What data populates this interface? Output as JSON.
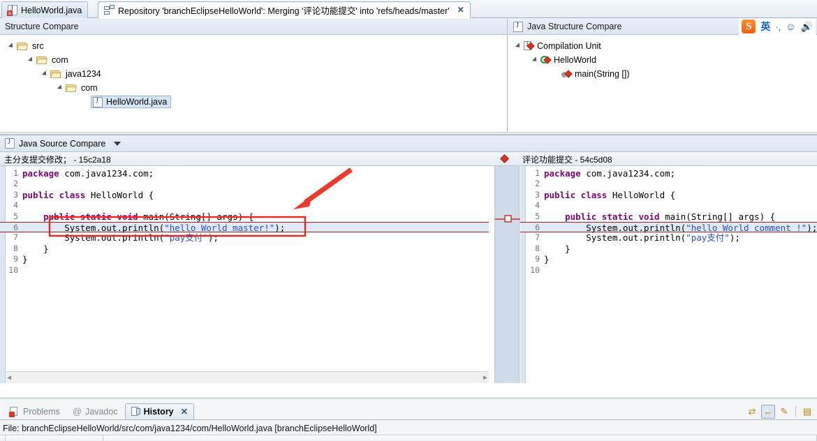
{
  "tabs": {
    "inactive": {
      "label": "HelloWorld.java",
      "icon": "java-file-error-icon"
    },
    "active": {
      "label": "Repository 'branchEclipseHelloWorld': Merging '评论功能提交' into 'refs/heads/master'",
      "icon": "repository-merge-icon",
      "close": "✕"
    }
  },
  "structure_compare": {
    "left": {
      "title": "Structure Compare",
      "tree": [
        {
          "label": "src",
          "depth": 0,
          "expanded": true,
          "icon": "folder-icon",
          "selected": false
        },
        {
          "label": "com",
          "depth": 1,
          "expanded": true,
          "icon": "folder-icon",
          "selected": false
        },
        {
          "label": "java1234",
          "depth": 2,
          "expanded": true,
          "icon": "folder-icon",
          "selected": false
        },
        {
          "label": "com",
          "depth": 3,
          "expanded": true,
          "icon": "folder-icon",
          "selected": false
        },
        {
          "label": "HelloWorld.java",
          "depth": 4,
          "expanded": false,
          "icon": "java-file-icon",
          "selected": true
        }
      ]
    },
    "right": {
      "title": "Java Structure Compare",
      "title_icon": "java-file-icon",
      "tree": [
        {
          "label": "Compilation Unit",
          "depth": 0,
          "expanded": true,
          "icon": "compilation-unit-icon",
          "changed": true
        },
        {
          "label": "HelloWorld",
          "depth": 1,
          "expanded": true,
          "icon": "java-class-icon",
          "changed": true
        },
        {
          "label": "main(String [])",
          "depth": 2,
          "expanded": false,
          "icon": "java-method-icon",
          "changed": true
        }
      ]
    }
  },
  "ime_toolbar": {
    "logo": "S",
    "items": [
      "英",
      "·,",
      "☺",
      "🎤"
    ],
    "names": [
      "sogou-logo-icon",
      "english-mode-icon",
      "punctuation-icon",
      "emoji-icon",
      "voice-input-icon"
    ]
  },
  "source_compare": {
    "title": "Java Source Compare",
    "title_icon": "java-file-icon",
    "menu_caret": "▼",
    "left_header": "主分支提交修改； - 15c2a18",
    "right_header": "评论功能提交 - 54c5d08",
    "left_code": [
      {
        "num": "1",
        "tokens": [
          {
            "t": "package ",
            "c": "kw"
          },
          {
            "t": "com.java1234.com;",
            "c": "plain"
          }
        ]
      },
      {
        "num": "2",
        "tokens": []
      },
      {
        "num": "3",
        "tokens": [
          {
            "t": "public class ",
            "c": "kw"
          },
          {
            "t": "HelloWorld {",
            "c": "plain"
          }
        ]
      },
      {
        "num": "4",
        "tokens": []
      },
      {
        "num": "5",
        "tokens": [
          {
            "t": "    ",
            "c": "plain"
          },
          {
            "t": "public static void ",
            "c": "kw"
          },
          {
            "t": "main(String[] args) {",
            "c": "plain"
          }
        ]
      },
      {
        "num": "6",
        "diff": true,
        "tokens": [
          {
            "t": "        System.out.println(",
            "c": "plain"
          },
          {
            "t": "\"hello World master!\"",
            "c": "str"
          },
          {
            "t": ");",
            "c": "plain"
          }
        ]
      },
      {
        "num": "7",
        "tokens": [
          {
            "t": "        System.out.println(",
            "c": "plain"
          },
          {
            "t": "\"pay支付\"",
            "c": "str"
          },
          {
            "t": ");",
            "c": "plain"
          }
        ]
      },
      {
        "num": "8",
        "tokens": [
          {
            "t": "    }",
            "c": "plain"
          }
        ]
      },
      {
        "num": "9",
        "tokens": [
          {
            "t": "}",
            "c": "plain"
          }
        ]
      },
      {
        "num": "10",
        "tokens": []
      }
    ],
    "right_code": [
      {
        "num": "1",
        "tokens": [
          {
            "t": "package ",
            "c": "kw"
          },
          {
            "t": "com.java1234.com;",
            "c": "plain"
          }
        ]
      },
      {
        "num": "2",
        "tokens": []
      },
      {
        "num": "3",
        "tokens": [
          {
            "t": "public class ",
            "c": "kw"
          },
          {
            "t": "HelloWorld {",
            "c": "plain"
          }
        ]
      },
      {
        "num": "4",
        "tokens": []
      },
      {
        "num": "5",
        "tokens": [
          {
            "t": "    ",
            "c": "plain"
          },
          {
            "t": "public static void ",
            "c": "kw"
          },
          {
            "t": "main(String[] args) {",
            "c": "plain"
          }
        ]
      },
      {
        "num": "6",
        "diff": true,
        "tokens": [
          {
            "t": "        System.out.println(",
            "c": "plain"
          },
          {
            "t": "\"hello World comment !\"",
            "c": "str"
          },
          {
            "t": ");",
            "c": "plain"
          }
        ]
      },
      {
        "num": "7",
        "tokens": [
          {
            "t": "        System.out.println(",
            "c": "plain"
          },
          {
            "t": "\"pay支付\"",
            "c": "str"
          },
          {
            "t": ");",
            "c": "plain"
          }
        ]
      },
      {
        "num": "8",
        "tokens": [
          {
            "t": "    }",
            "c": "plain"
          }
        ]
      },
      {
        "num": "9",
        "tokens": [
          {
            "t": "}",
            "c": "plain"
          }
        ]
      },
      {
        "num": "10",
        "tokens": []
      }
    ],
    "scroll_left_arrow": "◀",
    "scroll_right_arrow": "▶"
  },
  "annotation": {
    "box_color": "#e8251e",
    "arrow_color": "#ee3a2c"
  },
  "bottom": {
    "tabs": [
      {
        "label": "Problems",
        "icon": "problems-icon",
        "selected": false
      },
      {
        "label": "Javadoc",
        "icon": "javadoc-icon",
        "selected": false
      },
      {
        "label": "History",
        "icon": "history-icon",
        "selected": true,
        "close": "✕"
      }
    ],
    "toolbar": [
      {
        "name": "compare-mode-icon",
        "glyph": "⇄",
        "pressed": false
      },
      {
        "name": "link-with-editor-icon",
        "glyph": "⇔",
        "pressed": true
      },
      {
        "name": "edit-icon",
        "glyph": "✎",
        "pressed": false
      },
      {
        "name": "view-menu-icon",
        "glyph": "▤",
        "pressed": false
      }
    ],
    "file_label": "File: branchEclipseHelloWorld/src/com/java1234/com/HelloWorld.java [branchEclipseHelloWorld]"
  }
}
